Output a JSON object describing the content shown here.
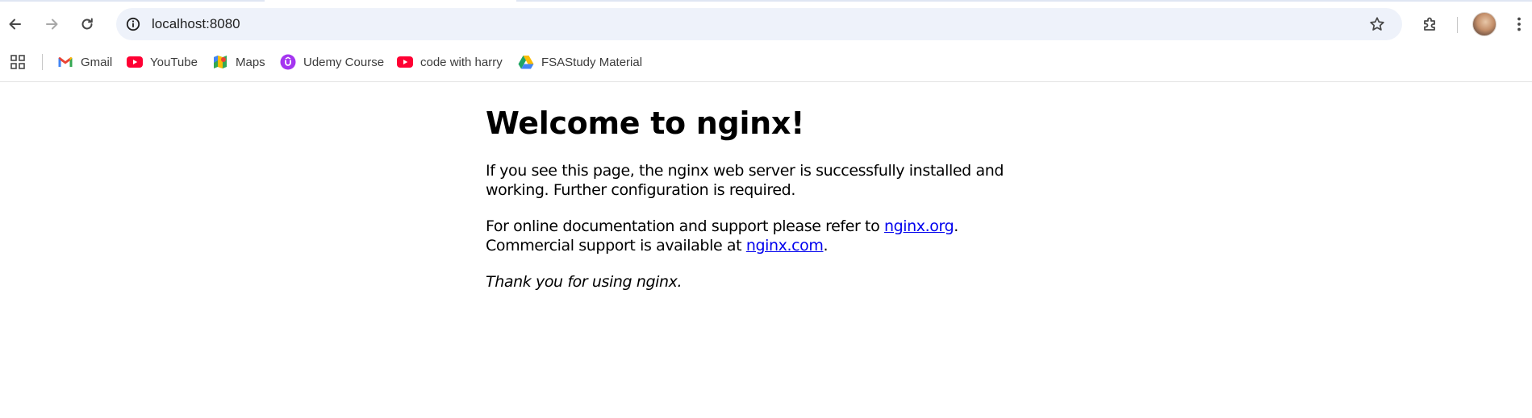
{
  "browser": {
    "url": "localhost:8080"
  },
  "bookmarks": [
    {
      "label": "Gmail",
      "icon": "gmail-icon"
    },
    {
      "label": "YouTube",
      "icon": "youtube-icon"
    },
    {
      "label": "Maps",
      "icon": "maps-icon"
    },
    {
      "label": "Udemy Course",
      "icon": "udemy-icon"
    },
    {
      "label": "code with harry",
      "icon": "youtube-icon"
    },
    {
      "label": "FSAStudy Material",
      "icon": "drive-icon"
    }
  ],
  "page": {
    "heading": "Welcome to nginx!",
    "para1": "If you see this page, the nginx web server is successfully installed and working. Further configuration is required.",
    "para2_prefix": "For online documentation and support please refer to ",
    "link1": "nginx.org",
    "para2_mid": ".",
    "para2_line2": "Commercial support is available at ",
    "link2": "nginx.com",
    "para2_end": ".",
    "thanks": "Thank you for using nginx."
  },
  "colors": {
    "omnibox_bg": "#eef2fa",
    "link": "#0000ee",
    "youtube_red": "#ff0033",
    "udemy_purple": "#a435f0"
  }
}
